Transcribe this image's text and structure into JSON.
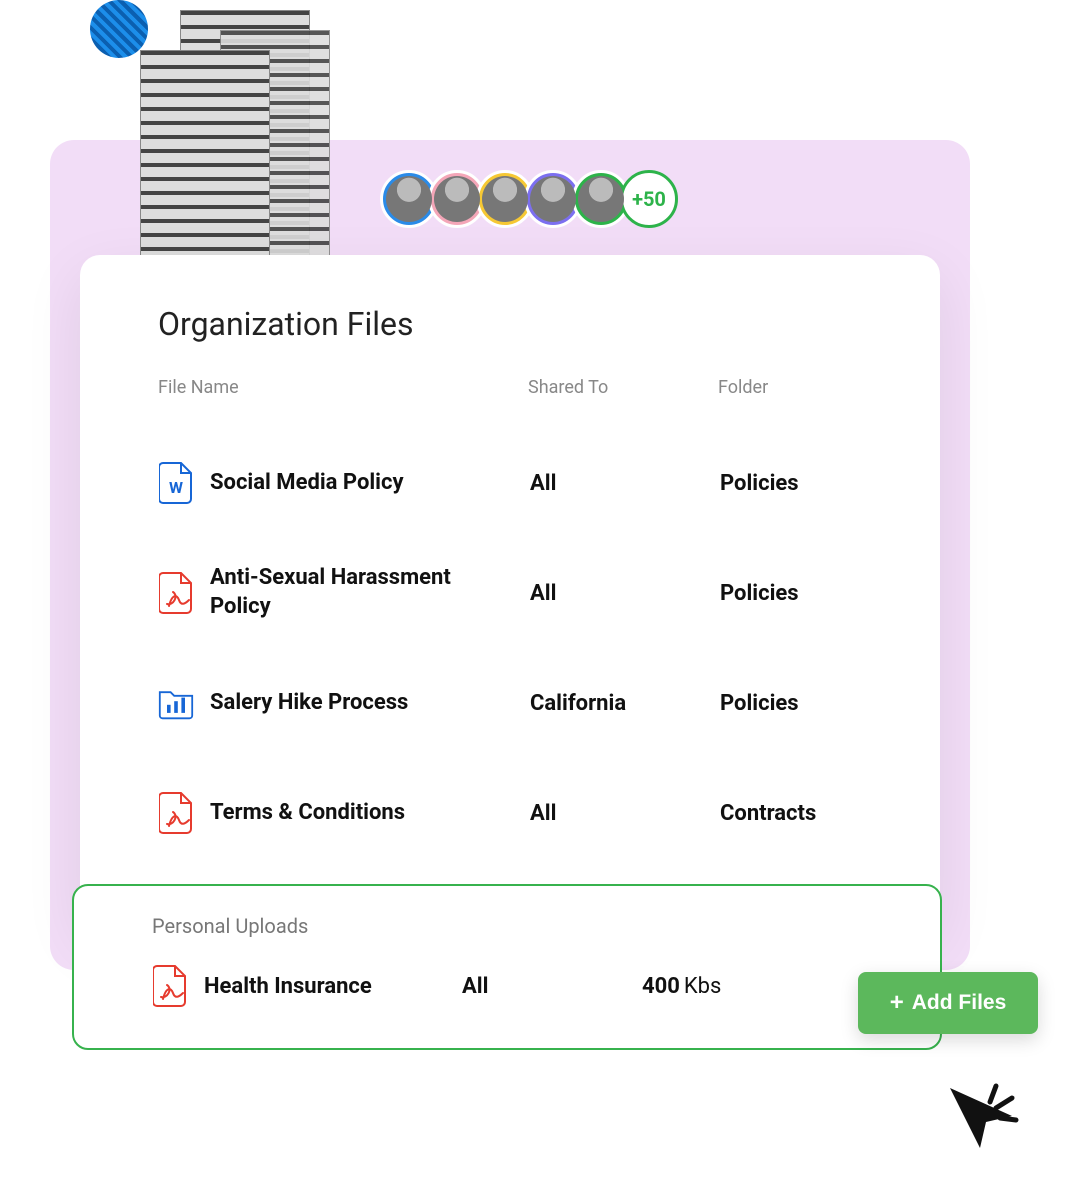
{
  "avatars": {
    "count_badge": "+50"
  },
  "org_files": {
    "title": "Organization Files",
    "columns": {
      "name": "File Name",
      "shared": "Shared To",
      "folder": "Folder"
    },
    "rows": [
      {
        "icon": "word-doc-icon",
        "name": "Social Media Policy",
        "shared": "All",
        "folder": "Policies"
      },
      {
        "icon": "pdf-icon",
        "name": "Anti-Sexual Harassment Policy",
        "shared": "All",
        "folder": "Policies"
      },
      {
        "icon": "chart-folder-icon",
        "name": "Salery Hike Process",
        "shared": "California",
        "folder": "Policies"
      },
      {
        "icon": "pdf-icon",
        "name": "Terms & Conditions",
        "shared": "All",
        "folder": "Contracts"
      }
    ]
  },
  "personal_uploads": {
    "title": "Personal Uploads",
    "row": {
      "icon": "pdf-icon",
      "name": "Health Insurance",
      "shared": "All",
      "size_value": "400",
      "size_unit": "Kbs"
    }
  },
  "add_button": {
    "label": "Add Files"
  }
}
